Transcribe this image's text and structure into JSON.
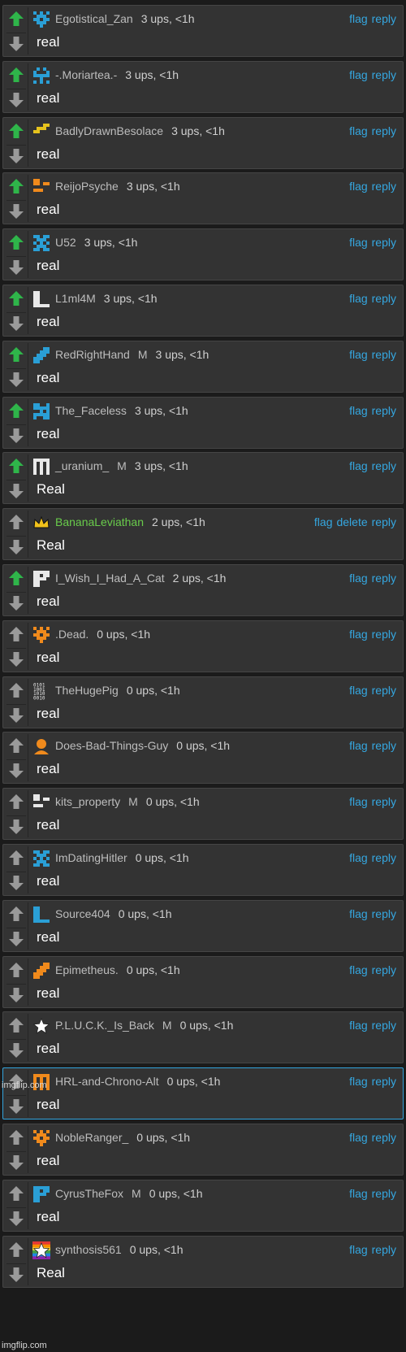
{
  "actions": {
    "flag": "flag",
    "delete": "delete",
    "reply": "reply"
  },
  "watermark": "imgflip.com",
  "colors": {
    "upvote_active": "#2fb54a",
    "vote_inactive": "#9a9a9a",
    "link": "#35a7e0",
    "mod_username": "#69cc4b"
  },
  "comments": [
    {
      "username": "Egotistical_Zan",
      "mod": "",
      "meta": "3 ups, <1h",
      "text": "real",
      "upvoted": true,
      "avatar_icon": "blue-pixel-avatar-icon",
      "avatar_color": "#2a9fd6",
      "show_delete": false
    },
    {
      "username": "-.Moriartea.-",
      "mod": "",
      "meta": "3 ups, <1h",
      "text": "real",
      "upvoted": true,
      "avatar_icon": "blue-pixel-avatar-icon",
      "avatar_color": "#2a9fd6",
      "show_delete": false
    },
    {
      "username": "BadlyDrawnBesolace",
      "mod": "",
      "meta": "3 ups, <1h",
      "text": "real",
      "upvoted": true,
      "avatar_icon": "yellow-pixel-avatar-icon",
      "avatar_color": "#e6c31d",
      "show_delete": false
    },
    {
      "username": "ReijoPsyche",
      "mod": "",
      "meta": "3 ups, <1h",
      "text": "real",
      "upvoted": true,
      "avatar_icon": "orange-pixel-avatar-icon",
      "avatar_color": "#f08a1c",
      "show_delete": false
    },
    {
      "username": "U52",
      "mod": "",
      "meta": "3 ups, <1h",
      "text": "real",
      "upvoted": true,
      "avatar_icon": "blue-pixel-avatar-icon",
      "avatar_color": "#2a9fd6",
      "show_delete": false
    },
    {
      "username": "L1ml4M",
      "mod": "",
      "meta": "3 ups, <1h",
      "text": "real",
      "upvoted": true,
      "avatar_icon": "white-pixel-avatar-icon",
      "avatar_color": "#e8e8e8",
      "show_delete": false
    },
    {
      "username": "RedRightHand",
      "mod": "M",
      "meta": "3 ups, <1h",
      "text": "real",
      "upvoted": true,
      "avatar_icon": "blue-pixel-avatar-icon",
      "avatar_color": "#2a9fd6",
      "show_delete": false
    },
    {
      "username": "The_Faceless",
      "mod": "",
      "meta": "3 ups, <1h",
      "text": "real",
      "upvoted": true,
      "avatar_icon": "blue-pixel-avatar-icon",
      "avatar_color": "#2a9fd6",
      "show_delete": false
    },
    {
      "username": "_uranium_",
      "mod": "M",
      "meta": "3 ups, <1h",
      "text": "Real",
      "upvoted": true,
      "avatar_icon": "white-pixel-avatar-icon",
      "avatar_color": "#e8e8e8",
      "show_delete": false
    },
    {
      "username": "BananaLeviathan",
      "mod": "",
      "meta": "2 ups, <1h",
      "text": "Real",
      "upvoted": false,
      "avatar_icon": "crown-icon",
      "avatar_color": "#f2c21b",
      "show_delete": true,
      "green_name": true
    },
    {
      "username": "I_Wish_I_Had_A_Cat",
      "mod": "",
      "meta": "2 ups, <1h",
      "text": "real",
      "upvoted": true,
      "avatar_icon": "white-pixel-avatar-icon",
      "avatar_color": "#e8e8e8",
      "show_delete": false
    },
    {
      "username": ".Dead.",
      "mod": "",
      "meta": "0 ups, <1h",
      "text": "real",
      "upvoted": false,
      "avatar_icon": "orange-pixel-avatar-icon",
      "avatar_color": "#f08a1c",
      "show_delete": false
    },
    {
      "username": "TheHugePig",
      "mod": "",
      "meta": "0 ups, <1h",
      "text": "real",
      "upvoted": false,
      "avatar_icon": "binary-avatar-icon",
      "avatar_color": "#e8e8e8",
      "show_delete": false
    },
    {
      "username": "Does-Bad-Things-Guy",
      "mod": "",
      "meta": "0 ups, <1h",
      "text": "real",
      "upvoted": false,
      "avatar_icon": "person-avatar-icon",
      "avatar_color": "#f08a1c",
      "show_delete": false
    },
    {
      "username": "kits_property",
      "mod": "M",
      "meta": "0 ups, <1h",
      "text": "real",
      "upvoted": false,
      "avatar_icon": "white-pixel-avatar-icon",
      "avatar_color": "#e8e8e8",
      "show_delete": false
    },
    {
      "username": "ImDatingHitler",
      "mod": "",
      "meta": "0 ups, <1h",
      "text": "real",
      "upvoted": false,
      "avatar_icon": "blue-pixel-avatar-icon",
      "avatar_color": "#2a9fd6",
      "show_delete": false
    },
    {
      "username": "Source404",
      "mod": "",
      "meta": "0 ups, <1h",
      "text": "real",
      "upvoted": false,
      "avatar_icon": "blue-pixel-avatar-icon",
      "avatar_color": "#2a9fd6",
      "show_delete": false
    },
    {
      "username": "Epimetheus.",
      "mod": "",
      "meta": "0 ups, <1h",
      "text": "real",
      "upvoted": false,
      "avatar_icon": "orange-pixel-avatar-icon",
      "avatar_color": "#f08a1c",
      "show_delete": false
    },
    {
      "username": "P.L.U.C.K._Is_Back",
      "mod": "M",
      "meta": "0 ups, <1h",
      "text": "real",
      "upvoted": false,
      "avatar_icon": "star-icon",
      "avatar_color": "#ffffff",
      "show_delete": false
    },
    {
      "username": "HRL-and-Chrono-Alt",
      "mod": "",
      "meta": "0 ups, <1h",
      "text": "real",
      "upvoted": false,
      "avatar_icon": "orange-pixel-avatar-icon",
      "avatar_color": "#f08a1c",
      "show_delete": false,
      "selected": true
    },
    {
      "username": "NobleRanger_",
      "mod": "",
      "meta": "0 ups, <1h",
      "text": "real",
      "upvoted": false,
      "avatar_icon": "orange-pixel-avatar-icon",
      "avatar_color": "#f08a1c",
      "show_delete": false
    },
    {
      "username": "CyrusTheFox",
      "mod": "M",
      "meta": "0 ups, <1h",
      "text": "real",
      "upvoted": false,
      "avatar_icon": "blue-pixel-avatar-icon",
      "avatar_color": "#2a9fd6",
      "show_delete": false
    },
    {
      "username": "synthosis561",
      "mod": "",
      "meta": "0 ups, <1h",
      "text": "Real",
      "upvoted": false,
      "avatar_icon": "rainbow-star-icon",
      "avatar_color": "#ffffff",
      "show_delete": false
    }
  ]
}
